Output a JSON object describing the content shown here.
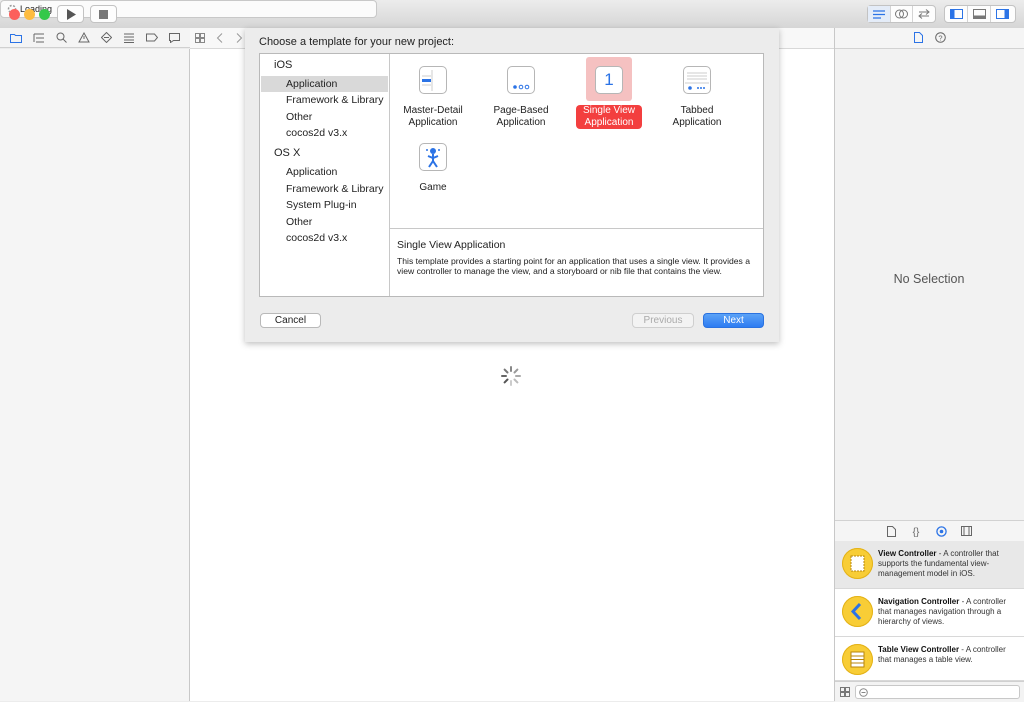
{
  "toolbar": {
    "activity_text": "Loading",
    "colors": {
      "close": "#fc605c",
      "minimize": "#fdbc40",
      "zoom": "#34c84a",
      "accent": "#2b73e6"
    }
  },
  "navigator": {
    "icons": [
      "folder-icon",
      "hierarchy-icon",
      "search-icon",
      "warning-icon",
      "test-diamond-icon",
      "debug-icon",
      "breakpoint-icon",
      "report-icon"
    ]
  },
  "sheet": {
    "title": "Choose a template for your new project:",
    "categories": [
      {
        "header": "iOS",
        "items": [
          "Application",
          "Framework & Library",
          "Other",
          "cocos2d v3.x"
        ]
      },
      {
        "header": "OS X",
        "items": [
          "Application",
          "Framework & Library",
          "System Plug-in",
          "Other",
          "cocos2d v3.x"
        ]
      }
    ],
    "selected_category": "iOS / Application",
    "templates": [
      {
        "line1": "Master-Detail",
        "line2": "Application"
      },
      {
        "line1": "Page-Based",
        "line2": "Application"
      },
      {
        "line1": "Single View",
        "line2": "Application",
        "icon_text": "1"
      },
      {
        "line1": "Tabbed",
        "line2": "Application"
      },
      {
        "line1": "Game",
        "line2": ""
      }
    ],
    "selected_template": "Single View Application",
    "description": {
      "title": "Single View Application",
      "text": "This template provides a starting point for an application that uses a single view. It provides a view controller to manage the view, and a storyboard or nib file that contains the view."
    },
    "buttons": {
      "cancel": "Cancel",
      "previous": "Previous",
      "next": "Next"
    }
  },
  "inspector": {
    "empty_text": "No Selection"
  },
  "library": {
    "items": [
      {
        "name": "View Controller",
        "desc": " - A controller that supports the fundamental view-management model in iOS."
      },
      {
        "name": "Navigation Controller",
        "desc": " - A controller that manages navigation through a hierarchy of views."
      },
      {
        "name": "Table View Controller",
        "desc": " - A controller that manages a table view."
      }
    ]
  }
}
